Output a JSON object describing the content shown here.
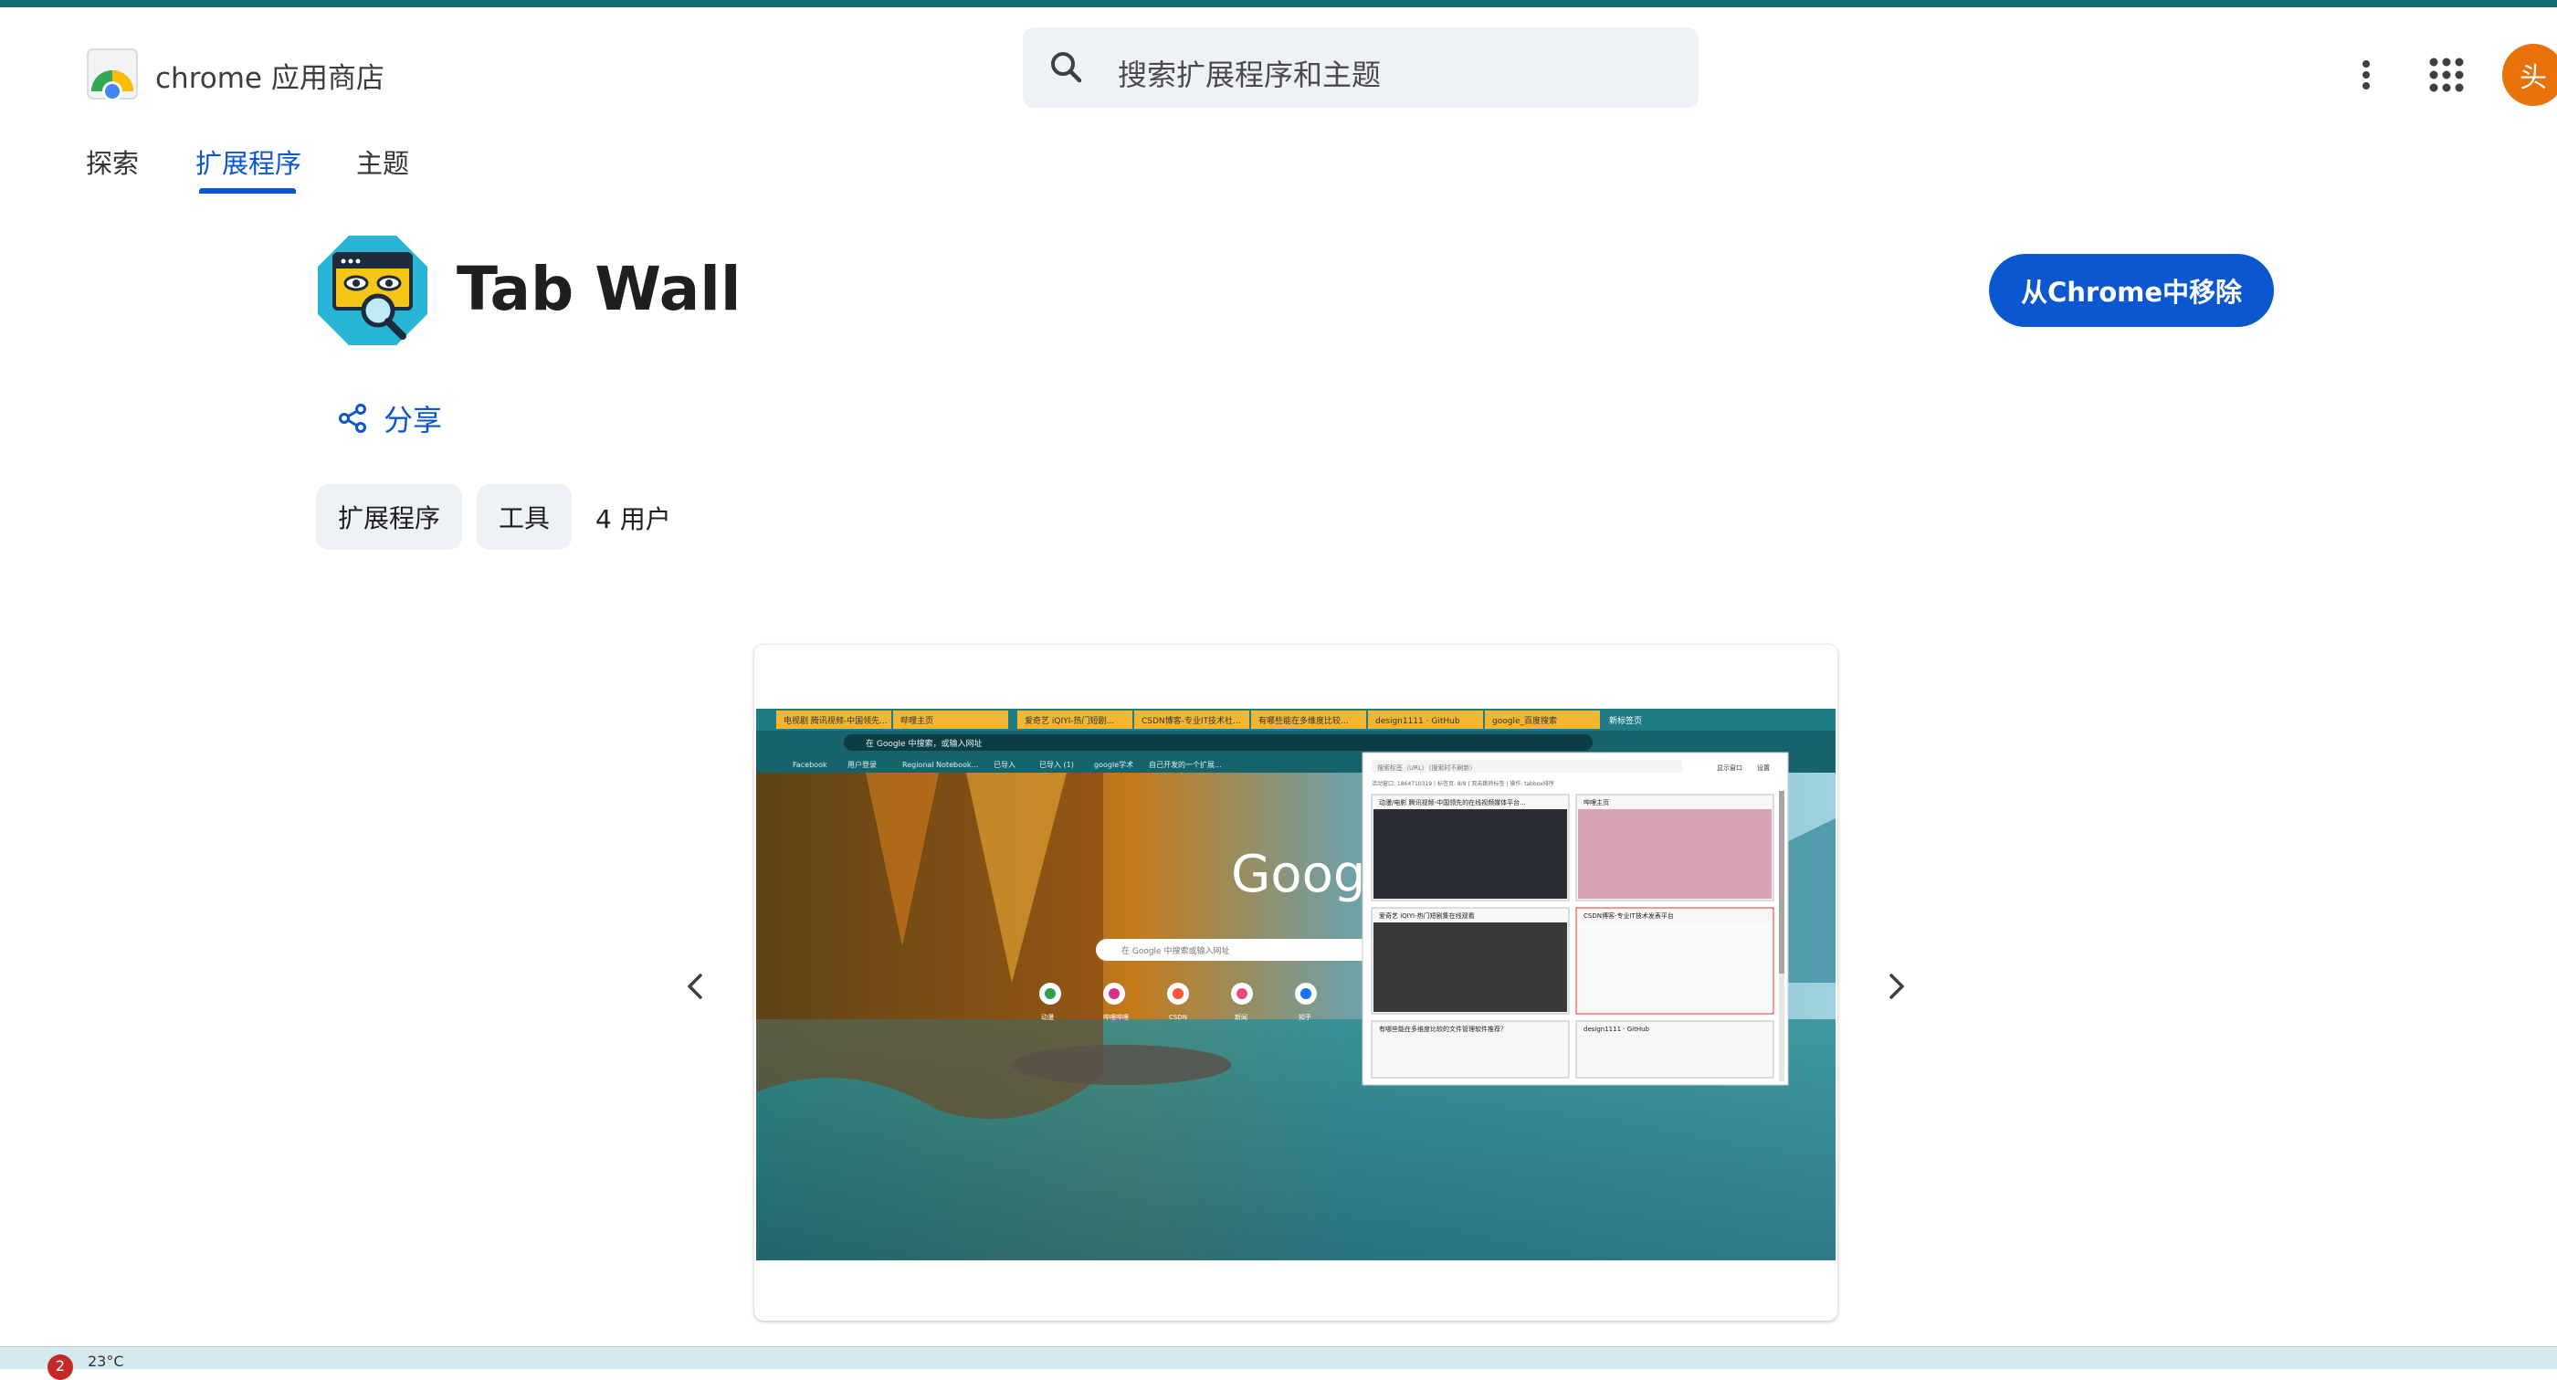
{
  "header": {
    "brand": "chrome 应用商店",
    "search_placeholder": "搜索扩展程序和主题",
    "avatar_letter": "头"
  },
  "nav": {
    "tabs": [
      {
        "label": "探索",
        "active": false
      },
      {
        "label": "扩展程序",
        "active": true
      },
      {
        "label": "主题",
        "active": false
      }
    ]
  },
  "extension": {
    "title": "Tab Wall",
    "remove_button": "从Chrome中移除",
    "share_label": "分享",
    "chips": [
      "扩展程序",
      "工具"
    ],
    "users": "4 用户"
  },
  "screenshot": {
    "browser_tabs": [
      "电视剧 腾讯视频-中国领先...",
      "哔哩主页",
      "爱奇艺 iQIYI-热门短剧...",
      "CSDN博客-专业IT技术社...",
      "有哪些能在多维度比较...",
      "design1111 · GitHub",
      "google_百度搜索",
      "新标签页"
    ],
    "address_text": "在 Google 中搜索，或输入网址",
    "bookmarks": [
      "Facebook",
      "用户登录",
      "Regional Notebook...",
      "已导入",
      "已导入 (1)",
      "google学术",
      "自己开发的一个扩展..."
    ],
    "google_text": "Google",
    "search_hint": "在 Google 中搜索或输入网址",
    "shortcuts": [
      "动漫",
      "哔哩哔哩",
      "CSDN",
      "新闻",
      "知乎"
    ],
    "panel": {
      "search_hint": "搜索标签（URL）（搜索时不刷新）",
      "show_label": "显示窗口",
      "settings": "设置",
      "info": "活动窗口: 1864710319 | 标签页: 8/8 | 双击跳转标签 | 操作: tabbox排序",
      "cards": [
        "动漫/电影 腾讯视频-中国领先的在线视频媒体平台...",
        "哔哩主页",
        "爱奇艺 iQIYI-热门短剧集在线观看",
        "CSDN博客-专业IT技术发表平台",
        "有哪些能在多维度比较的文件管理软件推荐？",
        "design1111 · GitHub"
      ]
    }
  },
  "taskbar": {
    "badge": "2",
    "weather": "23°C"
  },
  "colors": {
    "accent": "#0b57d0",
    "topbar": "#0f6e78",
    "avatar": "#e8710a"
  }
}
